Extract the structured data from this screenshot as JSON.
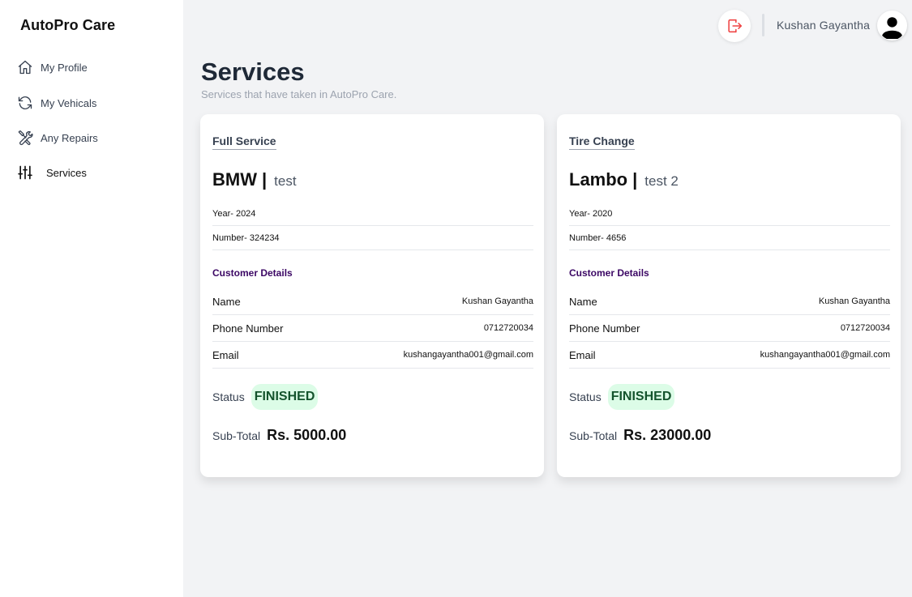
{
  "app": {
    "brand": "AutoPro Care"
  },
  "sidebar": {
    "items": [
      {
        "label": "My Profile",
        "icon": "home-icon"
      },
      {
        "label": "My Vehicals",
        "icon": "refresh-icon"
      },
      {
        "label": "Any Repairs",
        "icon": "tools-icon"
      },
      {
        "label": "Services",
        "icon": "sliders-icon",
        "active": true
      }
    ]
  },
  "header": {
    "user_name": "Kushan Gayantha",
    "logout_icon": "logout-icon",
    "avatar_icon": "user-avatar-icon"
  },
  "page": {
    "title": "Services",
    "subtitle": "Services that have taken in AutoPro Care."
  },
  "cards": [
    {
      "service_type": "Full Service",
      "brand": "BMW",
      "separator": "|",
      "model": "test",
      "year": "Year- 2024",
      "number": "Number- 324234",
      "customer_title": "Customer Details",
      "name_label": "Name",
      "name_value": "Kushan Gayantha",
      "phone_label": "Phone Number",
      "phone_value": "0712720034",
      "email_label": "Email",
      "email_value": "kushangayantha001@gmail.com",
      "status_label": "Status",
      "status_value": "FINISHED",
      "subtotal_label": "Sub-Total",
      "subtotal_value": "Rs. 5000.00"
    },
    {
      "service_type": "Tire Change",
      "brand": "Lambo",
      "separator": "|",
      "model": "test 2",
      "year": "Year- 2020",
      "number": "Number- 4656",
      "customer_title": "Customer Details",
      "name_label": "Name",
      "name_value": "Kushan Gayantha",
      "phone_label": "Phone Number",
      "phone_value": "0712720034",
      "email_label": "Email",
      "email_value": "kushangayantha001@gmail.com",
      "status_label": "Status",
      "status_value": "FINISHED",
      "subtotal_label": "Sub-Total",
      "subtotal_value": "Rs. 23000.00"
    }
  ],
  "colors": {
    "status_bg": "#dcfce7",
    "status_text": "#14532d",
    "logout_accent": "#ef4444",
    "section_title": "#3b0764"
  }
}
